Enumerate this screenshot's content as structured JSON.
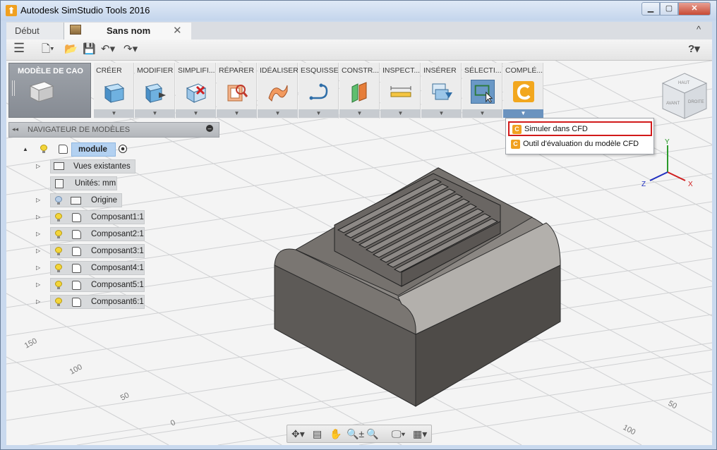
{
  "window": {
    "title": "Autodesk SimStudio Tools 2016",
    "minimize": "▁",
    "maximize": "▢",
    "close": "✕"
  },
  "tabs": {
    "debut": "Début",
    "doc": "Sans nom",
    "close": "✕",
    "collapse": "^"
  },
  "qat": {
    "menu": "☰",
    "new": "🗋▾",
    "open": "📂",
    "save": "💾",
    "undo": "↶▾",
    "redo": "↷▾",
    "help": "?▾"
  },
  "ribbon": {
    "workspace": "MODÈLE DE CAO",
    "groups": [
      "CRÉER",
      "MODIFIER",
      "SIMPLIFI...",
      "RÉPARER",
      "IDÉALISER",
      "ESQUISSE",
      "CONSTR...",
      "INSPECT...",
      "INSÉRER",
      "SÉLECTI...",
      "COMPLÉ..."
    ],
    "dropdown_arrow": "▼"
  },
  "browser": {
    "arrow": "◂◂",
    "title": "NAVIGATEUR DE MODÈLES",
    "minimize": "–",
    "root": "module",
    "expand": "▲",
    "collapsed": "▷",
    "items": [
      "Vues existantes",
      "Unités: mm",
      "Origine",
      "Composant1:1",
      "Composant2:1",
      "Composant3:1",
      "Composant4:1",
      "Composant5:1",
      "Composant6:1"
    ]
  },
  "complements_menu": [
    "Simuler dans CFD",
    "Outil d'évaluation du modèle CFD"
  ],
  "viewcube": {
    "top": "HAUT",
    "front": "AVANT",
    "right": "DROITE"
  },
  "axes": {
    "x": "X",
    "y": "Y",
    "z": "Z"
  },
  "grid_labels": [
    "150",
    "100",
    "50",
    "0",
    "50",
    "100"
  ],
  "navbar": {
    "orbit": "✥▾",
    "look": "▤",
    "pan": "✋",
    "zoom": "🔍±",
    "fit": "🔍",
    "display": "🖵▾",
    "grid": "▦▾"
  },
  "colors": {
    "accent": "#f0a020",
    "highlight_red": "#d21a1a",
    "selected_blue": "#6a98c6",
    "body_gray": "#5f5c58"
  }
}
